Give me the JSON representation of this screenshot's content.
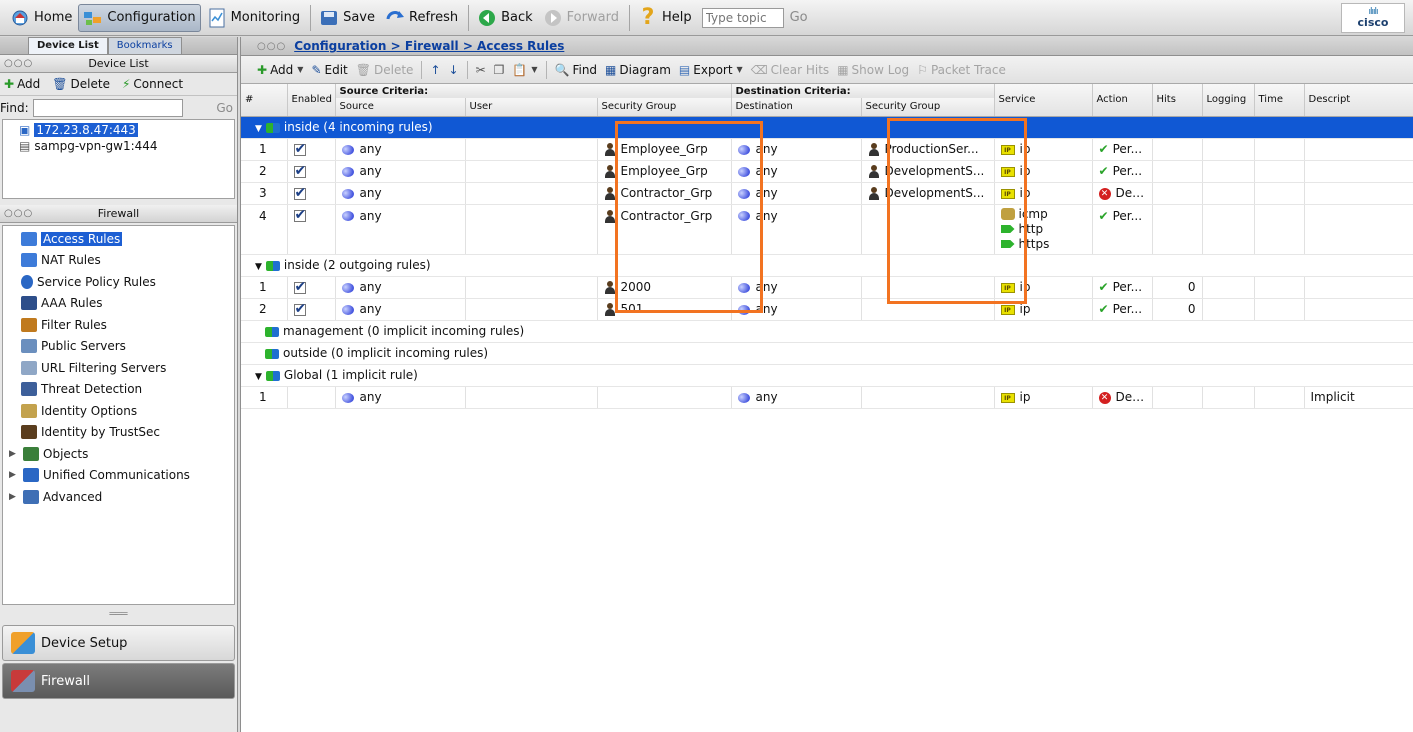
{
  "toolbar": {
    "home": "Home",
    "configuration": "Configuration",
    "monitoring": "Monitoring",
    "save": "Save",
    "refresh": "Refresh",
    "back": "Back",
    "forward": "Forward",
    "help": "Help",
    "topic_placeholder": "Type topic",
    "go": "Go",
    "logo_word": "cisco",
    "logo_bars": "ılıılı"
  },
  "left": {
    "tabs": [
      "Device List",
      "Bookmarks"
    ],
    "device_list": {
      "title": "Device List",
      "add": "Add",
      "delete": "Delete",
      "connect": "Connect",
      "find_label": "Find:",
      "go": "Go",
      "devices": [
        "172.23.8.47:443",
        "sampg-vpn-gw1:444"
      ]
    },
    "firewall": {
      "title": "Firewall",
      "items": [
        {
          "label": "Access Rules",
          "icon": "access-rules-icon",
          "color": "#3d7bd9"
        },
        {
          "label": "NAT Rules",
          "icon": "nat-rules-icon",
          "color": "#3d7bd9"
        },
        {
          "label": "Service Policy Rules",
          "icon": "service-policy-icon",
          "color": "#2a67c4"
        },
        {
          "label": "AAA Rules",
          "icon": "aaa-rules-icon",
          "color": "#2d4e8a"
        },
        {
          "label": "Filter Rules",
          "icon": "filter-rules-icon",
          "color": "#c07a1e"
        },
        {
          "label": "Public Servers",
          "icon": "public-servers-icon",
          "color": "#6b8fbe"
        },
        {
          "label": "URL Filtering Servers",
          "icon": "url-filtering-icon",
          "color": "#8fa7c6"
        },
        {
          "label": "Threat Detection",
          "icon": "threat-detection-icon",
          "color": "#3d5f9a"
        },
        {
          "label": "Identity Options",
          "icon": "identity-options-icon",
          "color": "#c3a24d"
        },
        {
          "label": "Identity by TrustSec",
          "icon": "identity-trustsec-icon",
          "color": "#5a3d1e"
        },
        {
          "label": "Objects",
          "icon": "objects-icon",
          "color": "#3a7f3a",
          "tree": true
        },
        {
          "label": "Unified Communications",
          "icon": "unified-comm-icon",
          "color": "#2a67c4",
          "tree": true
        },
        {
          "label": "Advanced",
          "icon": "advanced-icon",
          "color": "#3f6fb5",
          "tree": true
        }
      ]
    },
    "bottom_buttons": [
      "Device Setup",
      "Firewall"
    ]
  },
  "main": {
    "breadcrumb": "Configuration > Firewall > Access Rules",
    "actions": {
      "add": "Add",
      "edit": "Edit",
      "delete": "Delete",
      "find": "Find",
      "diagram": "Diagram",
      "export": "Export",
      "clear_hits": "Clear Hits",
      "show_log": "Show Log",
      "packet_trace": "Packet Trace"
    },
    "columns": {
      "num": "#",
      "enabled": "Enabled",
      "source_criteria": "Source Criteria:",
      "source": "Source",
      "user": "User",
      "security_group": "Security Group",
      "dest_criteria": "Destination Criteria:",
      "destination": "Destination",
      "dest_security_group": "Security Group",
      "service": "Service",
      "action": "Action",
      "hits": "Hits",
      "logging": "Logging",
      "time": "Time",
      "description": "Descript"
    },
    "groups": [
      {
        "label": "inside (4 incoming rules)",
        "rules": [
          {
            "num": "1",
            "source": "any",
            "sgt": "Employee_Grp",
            "dest": "any",
            "dest_sgt": "ProductionSer...",
            "services": [
              "ip"
            ],
            "action": "Per...",
            "hits": ""
          },
          {
            "num": "2",
            "source": "any",
            "sgt": "Employee_Grp",
            "dest": "any",
            "dest_sgt": "DevelopmentS...",
            "services": [
              "ip"
            ],
            "action": "Per...",
            "hits": ""
          },
          {
            "num": "3",
            "source": "any",
            "sgt": "Contractor_Grp",
            "dest": "any",
            "dest_sgt": "DevelopmentS...",
            "services": [
              "ip"
            ],
            "action": "Deny",
            "hits": ""
          },
          {
            "num": "4",
            "source": "any",
            "sgt": "Contractor_Grp",
            "dest": "any",
            "dest_sgt": "",
            "services": [
              "icmp",
              "http",
              "https"
            ],
            "action": "Per...",
            "hits": ""
          }
        ]
      },
      {
        "label": "inside (2 outgoing rules)",
        "rules": [
          {
            "num": "1",
            "source": "any",
            "sgt": "2000",
            "dest": "any",
            "dest_sgt": "",
            "services": [
              "ip"
            ],
            "action": "Per...",
            "hits": "0"
          },
          {
            "num": "2",
            "source": "any",
            "sgt": "501",
            "dest": "any",
            "dest_sgt": "",
            "services": [
              "ip"
            ],
            "action": "Per...",
            "hits": "0"
          }
        ]
      },
      {
        "label": "management (0 implicit incoming rules)"
      },
      {
        "label": "outside (0 implicit incoming rules)"
      },
      {
        "label": "Global (1 implicit rule)",
        "rules": [
          {
            "num": "1",
            "source": "any",
            "sgt": "",
            "dest": "any",
            "dest_sgt": "",
            "services": [
              "ip"
            ],
            "action": "Deny",
            "hits": "",
            "description": "Implicit"
          }
        ]
      }
    ]
  }
}
